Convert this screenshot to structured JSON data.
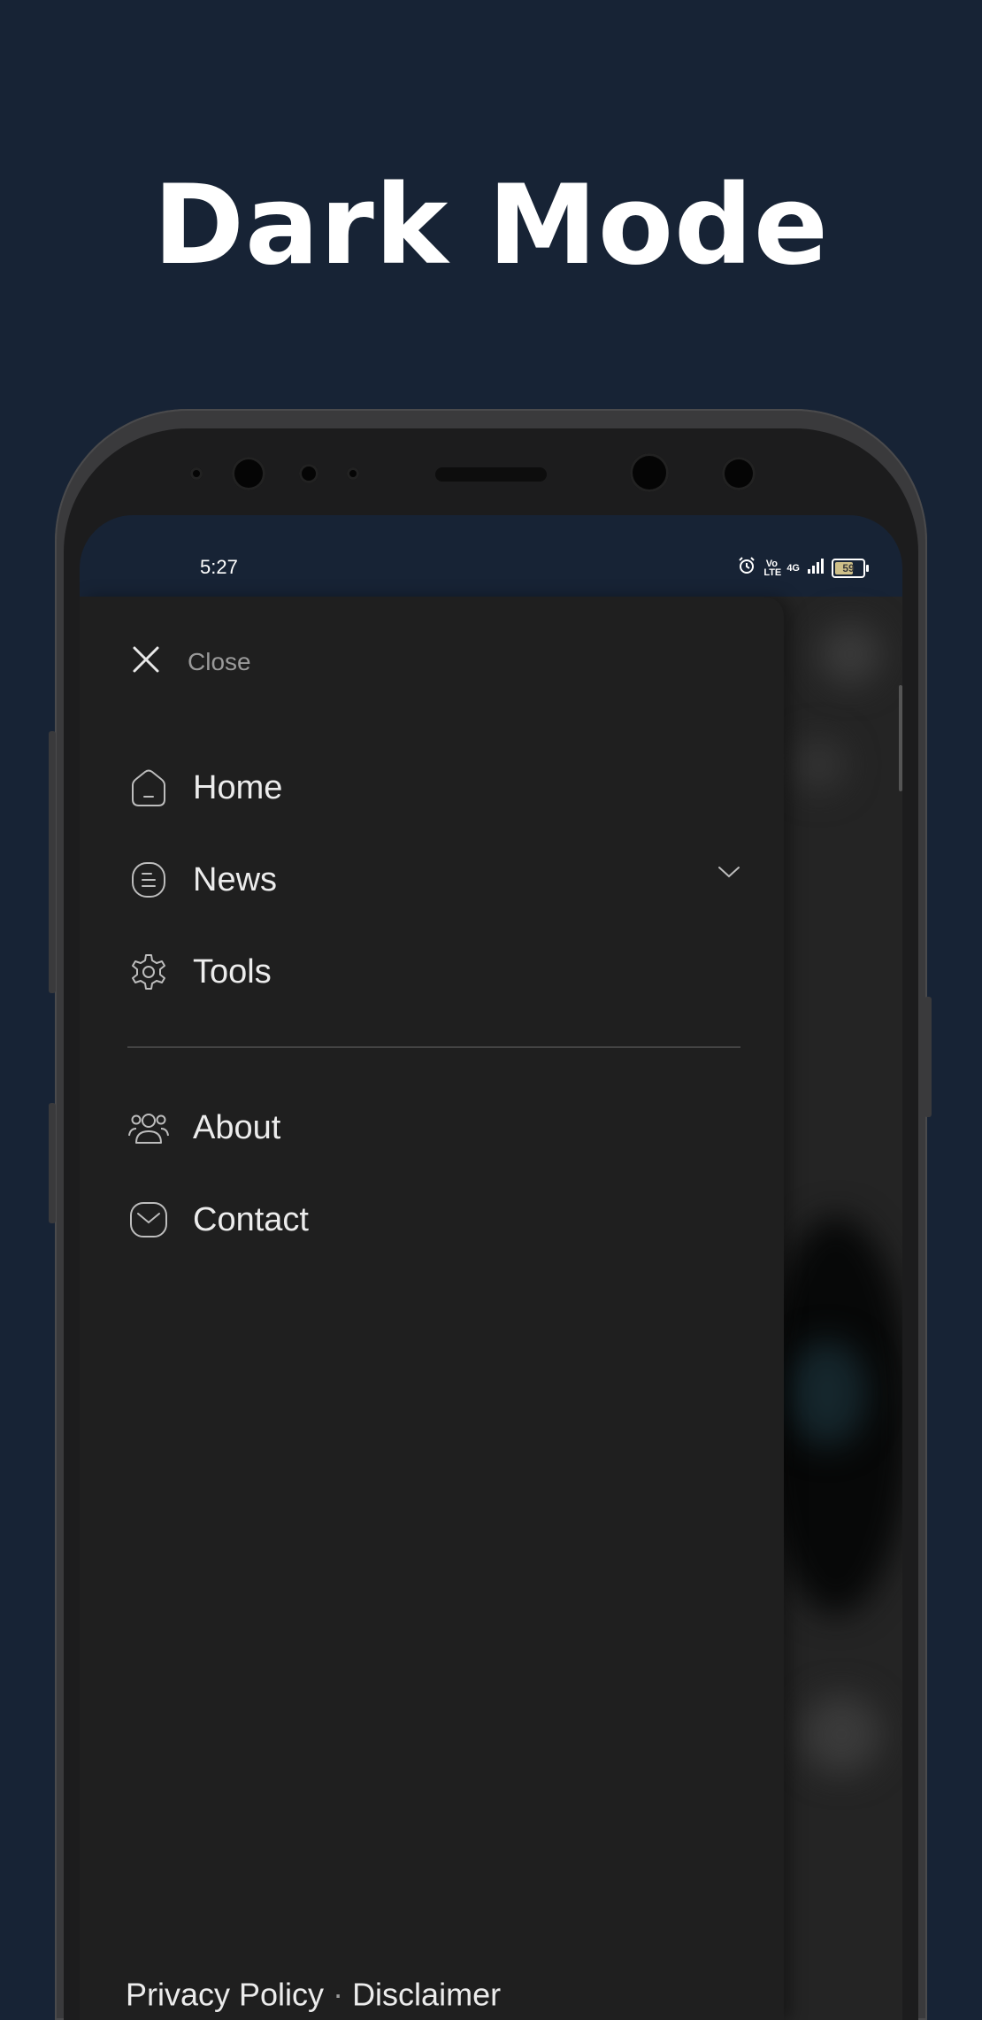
{
  "promo": {
    "headline": "Dark Mode"
  },
  "status_bar": {
    "time": "5:27",
    "network": "4G",
    "volte": "Vo LTE",
    "battery": "59"
  },
  "drawer": {
    "close_label": "Close",
    "items": [
      {
        "label": "Home",
        "icon": "home-icon"
      },
      {
        "label": "News",
        "icon": "news-icon",
        "expandable": true
      },
      {
        "label": "Tools",
        "icon": "gear-icon"
      }
    ],
    "secondary_items": [
      {
        "label": "About",
        "icon": "people-icon"
      },
      {
        "label": "Contact",
        "icon": "mail-icon"
      }
    ],
    "footer": {
      "privacy": "Privacy Policy",
      "separator": "·",
      "disclaimer": "Disclaimer"
    }
  },
  "colors": {
    "background": "#172335",
    "drawer": "#1f1f1f",
    "text": "#ececec"
  }
}
